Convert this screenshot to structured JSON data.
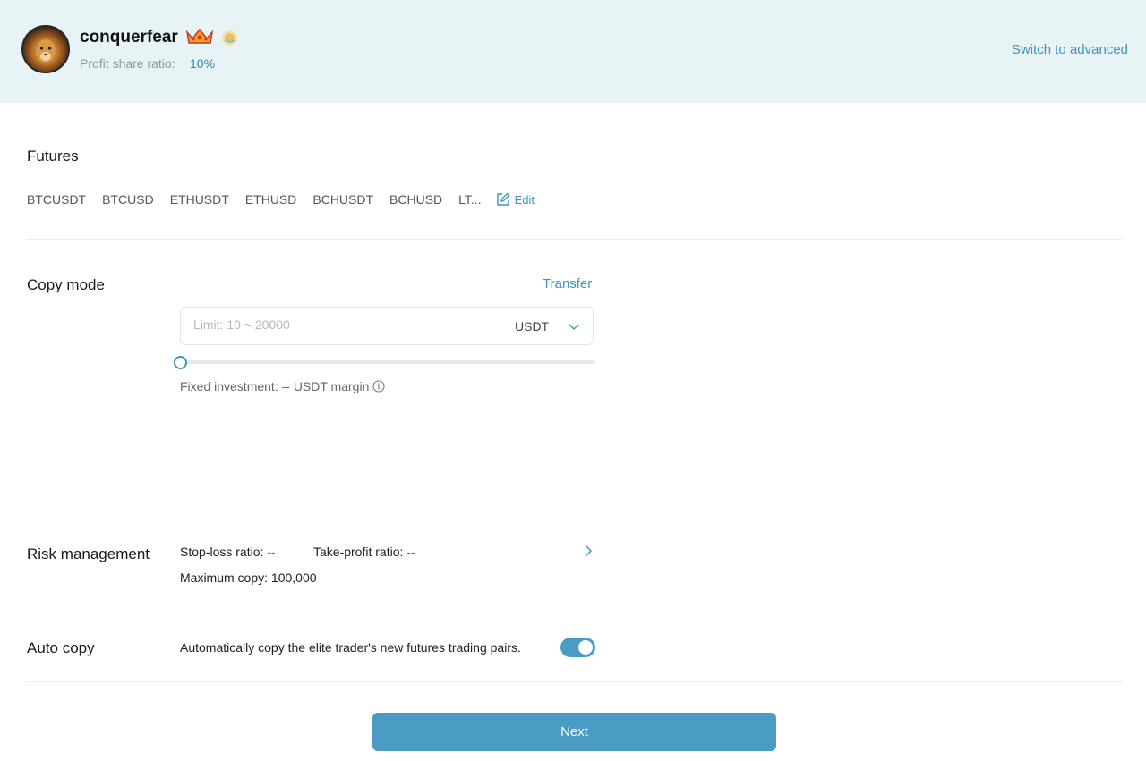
{
  "trader": {
    "name": "conquerfear",
    "profit_share_label": "Profit share ratio:",
    "profit_share_value": "10%"
  },
  "header": {
    "switch_label": "Switch to advanced"
  },
  "futures": {
    "title": "Futures",
    "pairs": [
      "BTCUSDT",
      "BTCUSD",
      "ETHUSDT",
      "ETHUSD",
      "BCHUSDT",
      "BCHUSD",
      "LT..."
    ],
    "edit_label": "Edit"
  },
  "copy_mode": {
    "title": "Copy mode",
    "transfer_label": "Transfer",
    "amount_placeholder": "Limit: 10 ~ 20000",
    "amount_value": "",
    "currency": "USDT",
    "slider_percent": 0,
    "fixed_investment": "Fixed investment: -- USDT margin"
  },
  "risk": {
    "title": "Risk management",
    "stop_loss_label": "Stop-loss ratio:",
    "stop_loss_value": "--",
    "take_profit_label": "Take-profit ratio:",
    "take_profit_value": "--",
    "max_copy": "Maximum copy: 100,000"
  },
  "auto_copy": {
    "title": "Auto copy",
    "description": "Automatically copy the elite trader's new futures trading pairs.",
    "enabled": true
  },
  "actions": {
    "next_label": "Next"
  },
  "colors": {
    "accent": "#4a9cc4",
    "link": "#3d94bc",
    "header_bg": "#e8f3f5",
    "negative": "#d9442c"
  }
}
